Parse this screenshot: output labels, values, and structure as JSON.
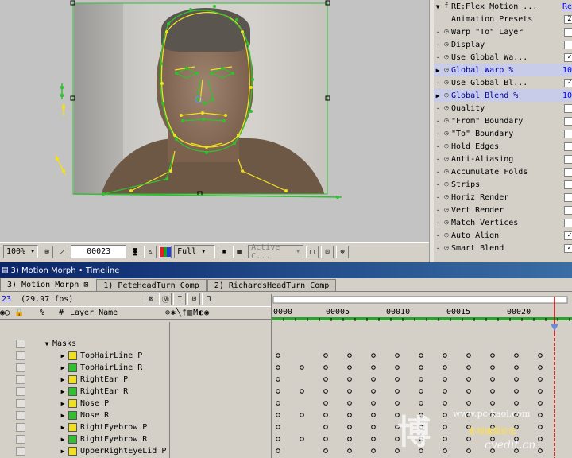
{
  "colors": {
    "mask_yellow": "#f0e020",
    "mask_green": "#30c030",
    "timeline_title_bg": "#0a246a",
    "cti_red": "#c00000"
  },
  "comp_toolbar": {
    "zoom": "100%",
    "timecode": "00023",
    "resolution": "Full",
    "view": "Active C..."
  },
  "effects": {
    "header": "RE:Flex Motion ...",
    "header_right": "Re",
    "rows": [
      {
        "label": "Animation Presets",
        "ctl": "2",
        "tri": ""
      },
      {
        "label": "Warp \"To\" Layer",
        "ctl": "",
        "tri": "·"
      },
      {
        "label": "Display",
        "ctl": "",
        "tri": "·"
      },
      {
        "label": "Use Global Wa...",
        "ctl": "✓",
        "tri": "·"
      },
      {
        "label": "Global Warp %",
        "val": "10",
        "tri": "▶"
      },
      {
        "label": "Use Global Bl...",
        "ctl": "✓",
        "tri": "·"
      },
      {
        "label": "Global Blend %",
        "val": "10",
        "tri": "▶"
      },
      {
        "label": "Quality",
        "ctl": "",
        "tri": "·"
      },
      {
        "label": "\"From\" Boundary",
        "ctl": "",
        "tri": "·"
      },
      {
        "label": "\"To\" Boundary",
        "ctl": "",
        "tri": "·"
      },
      {
        "label": "Hold Edges",
        "ctl": "",
        "tri": "·"
      },
      {
        "label": "Anti-Aliasing",
        "ctl": "",
        "tri": "·"
      },
      {
        "label": "Accumulate Folds",
        "ctl": "",
        "tri": "·"
      },
      {
        "label": "Strips",
        "ctl": "",
        "tri": "·"
      },
      {
        "label": "Horiz Render",
        "ctl": "",
        "tri": "·"
      },
      {
        "label": "Vert Render",
        "ctl": "",
        "tri": "·"
      },
      {
        "label": "Match Vertices",
        "ctl": "",
        "tri": "·"
      },
      {
        "label": "Auto Align",
        "ctl": "✓",
        "tri": "·"
      },
      {
        "label": "Smart Blend",
        "ctl": "✓",
        "tri": "·"
      }
    ]
  },
  "timeline": {
    "title": "3) Motion Morph • Timeline",
    "tabs": [
      "3) Motion Morph",
      "1) PeteHeadTurn Comp",
      "2) RichardsHeadTurn Comp"
    ],
    "time_frames": "23",
    "fps": "(29.97 fps)",
    "layer_name_header": "Layer Name",
    "ruler_labels": [
      "0000",
      "00005",
      "00010",
      "00015",
      "00020"
    ],
    "group": "Masks",
    "layers": [
      {
        "name": "TopHairLine P",
        "color": "#f0e020"
      },
      {
        "name": "TopHairLine R",
        "color": "#30c030"
      },
      {
        "name": "RightEar P",
        "color": "#f0e020"
      },
      {
        "name": "RightEar R",
        "color": "#30c030"
      },
      {
        "name": "Nose P",
        "color": "#f0e020"
      },
      {
        "name": "Nose R",
        "color": "#30c030"
      },
      {
        "name": "RightEyebrow P",
        "color": "#f0e020"
      },
      {
        "name": "RightEyebrow R",
        "color": "#30c030"
      },
      {
        "name": "UpperRightEyeLid P",
        "color": "#f0e020"
      }
    ]
  },
  "watermark": {
    "line1": "www.pc-kaoi.com",
    "line2": "cvedit.cn",
    "line3": "影视编辑论坛"
  }
}
